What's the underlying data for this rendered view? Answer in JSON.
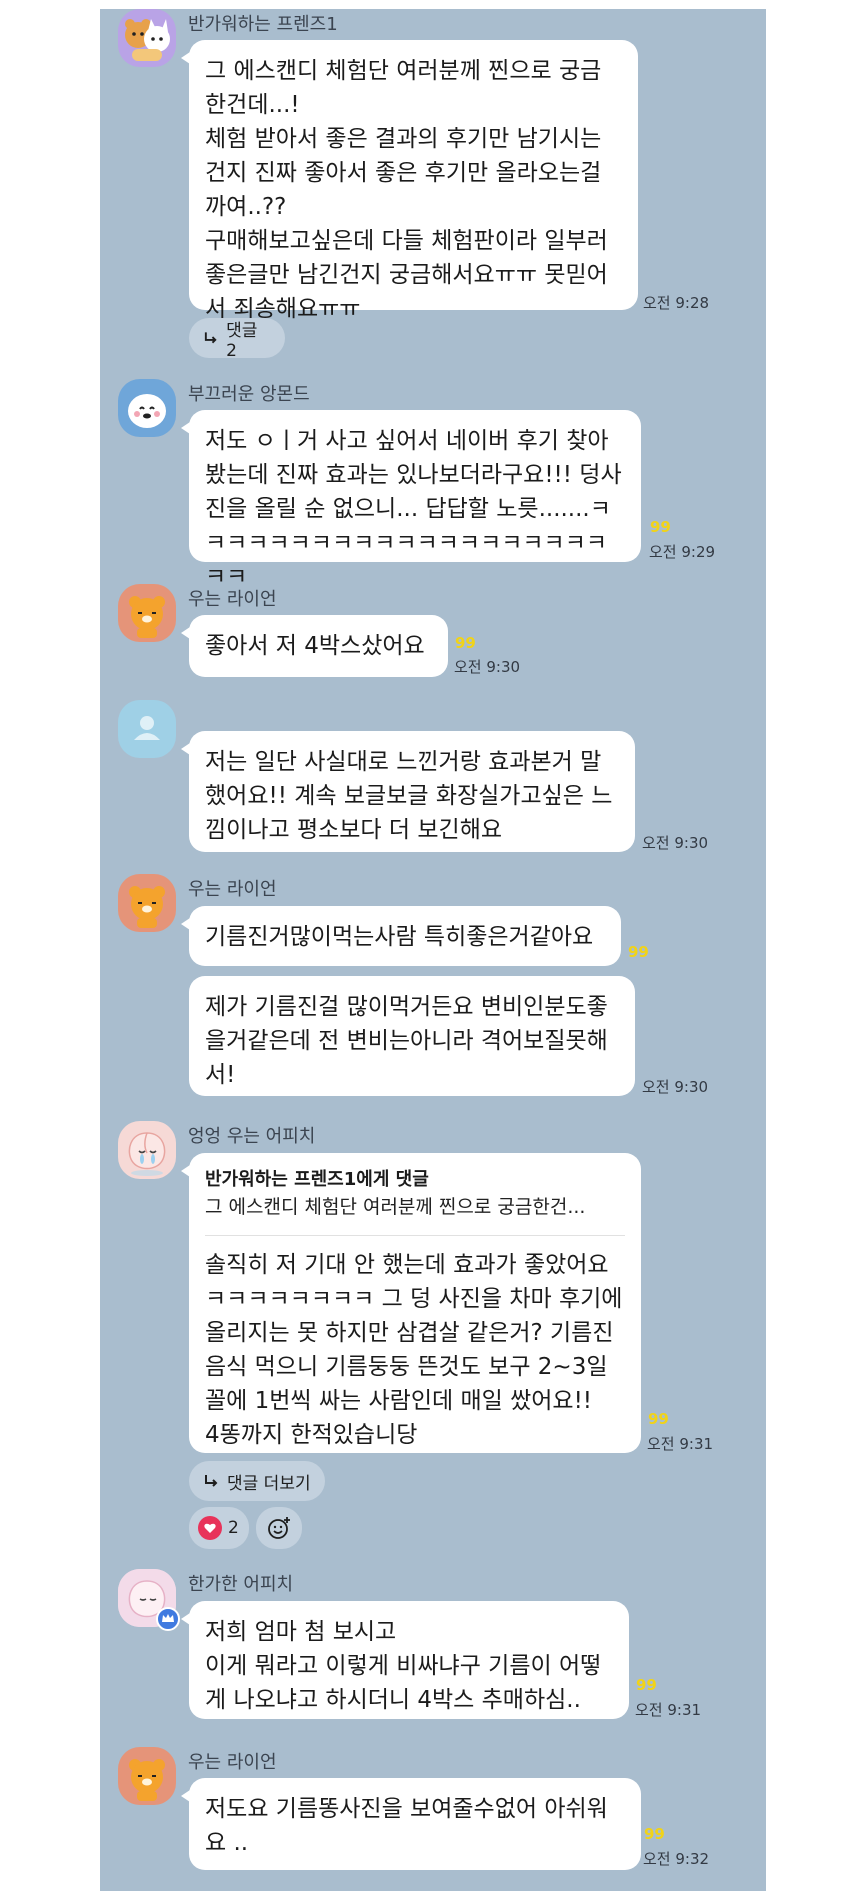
{
  "messages": {
    "m1": {
      "sender": "반가워하는 프렌즈1",
      "text": "그 에스캔디 체험단 여러분께 찐으로 궁금\n한건데...!\n체험 받아서 좋은 결과의 후기만 남기시는\n건지 진짜 좋아서 좋은 후기만 올라오는걸\n까여..??\n구매해보고싶은데 다들 체험판이라 일부러\n좋은글만 남긴건지 궁금해서요ㅠㅠ 못믿어\n서 죄송해요ㅠㅠ",
      "time": "오전 9:28",
      "replies_label": "댓글 2"
    },
    "m2": {
      "sender": "부끄러운 앙몬드",
      "text": "저도 ㅇㅣ거 사고 싶어서 네이버 후기 찾아\n봤는데 진짜 효과는 있나보더라구요!!! 덩사\n진을 올릴 순 없으니... 답답할 노릇.......ㅋ\nㅋㅋㅋㅋㅋㅋㅋㅋㅋㅋㅋㅋㅋㅋㅋㅋㅋㅋㅋㅋㅋ",
      "unread": "99",
      "time": "오전 9:29"
    },
    "m3": {
      "sender": "우는 라이언",
      "text": "좋아서 저 4박스샀어요",
      "unread": "99",
      "time": "오전 9:30"
    },
    "m4": {
      "text": "저는 일단 사실대로 느낀거랑 효과본거 말\n했어요!! 계속 보글보글 화장실가고싶은 느\n낌이나고 평소보다 더 보긴해요",
      "time": "오전 9:30"
    },
    "m5": {
      "sender": "우는 라이언",
      "text": "기름진거많이먹는사람 특히좋은거같아요",
      "unread": "99"
    },
    "m6": {
      "text": "제가 기름진걸 많이먹거든요 변비인분도좋\n을거같은데 전 변비는아니라 격어보질못해\n서!",
      "time": "오전 9:30"
    },
    "m7": {
      "sender": "엉엉 우는 어피치",
      "reply_to": "반가워하는 프렌즈1에게 댓글",
      "reply_quote": "그 에스캔디 체험단 여러분께 찐으로 궁금한건...",
      "text": "솔직히 저 기대 안 했는데 효과가 좋았어요\nㅋㅋㅋㅋㅋㅋㅋㅋ  그 덩 사진을 차마 후기에\n올리지는 못 하지만 삼겹살 같은거? 기름진\n음식 먹으니 기름둥둥 뜬것도 보구 2~3일\n꼴에 1번씩 싸는 사람인데 매일 쌌어요!!\n4똥까지 한적있습니당",
      "unread": "99",
      "time": "오전 9:31",
      "more_replies_label": "댓글 더보기",
      "reaction_count": "2"
    },
    "m8": {
      "sender": "한가한 어피치",
      "text": "저희 엄마 첨 보시고\n이게 뭐라고 이렇게 비싸냐구 기름이 어떻\n게 나오냐고 하시더니 4박스 추매하심..",
      "unread": "99",
      "time": "오전 9:31"
    },
    "m9": {
      "sender": "우는 라이언",
      "text": "저도요 기름똥사진을 보여줄수없어 아쉬워\n요 ..",
      "unread": "99",
      "time": "오전 9:32"
    }
  },
  "icons": {
    "reply_arrow": "reply-arrow-icon",
    "heart": "heart-icon",
    "add_reaction": "add-reaction-icon",
    "crown": "crown-icon",
    "default_profile": "person-icon"
  },
  "colors": {
    "chat_bg": "#a9bdce",
    "bubble": "#ffffff",
    "unread": "#f1d318",
    "heart": "#e8335a",
    "crown": "#3f7ae0"
  }
}
